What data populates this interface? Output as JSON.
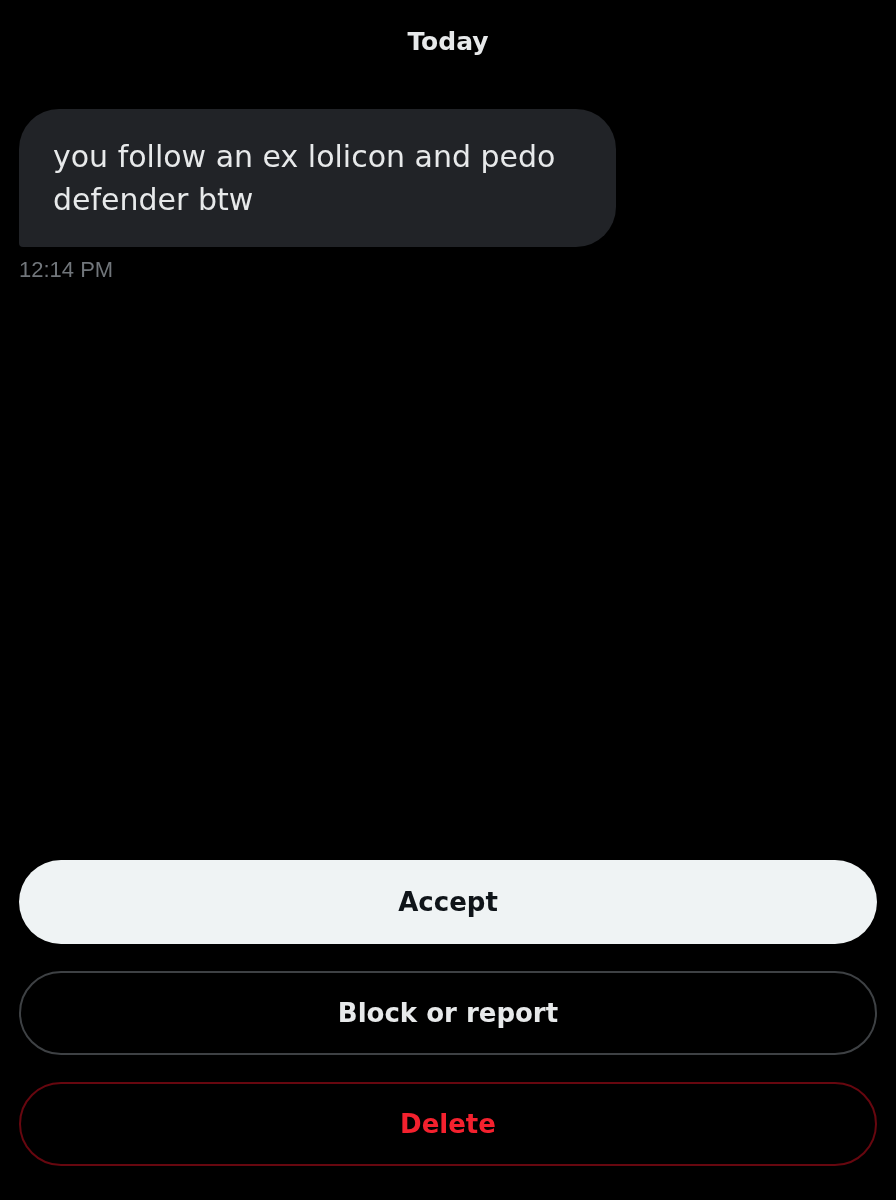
{
  "date_divider": "Today",
  "messages": [
    {
      "text": "you follow an ex lolicon and pedo defender btw",
      "time": "12:14 PM"
    }
  ],
  "buttons": [
    {
      "label": "Accept",
      "kind": "primary"
    },
    {
      "label": "Block or report",
      "kind": "outline"
    },
    {
      "label": "Delete",
      "kind": "danger"
    }
  ]
}
